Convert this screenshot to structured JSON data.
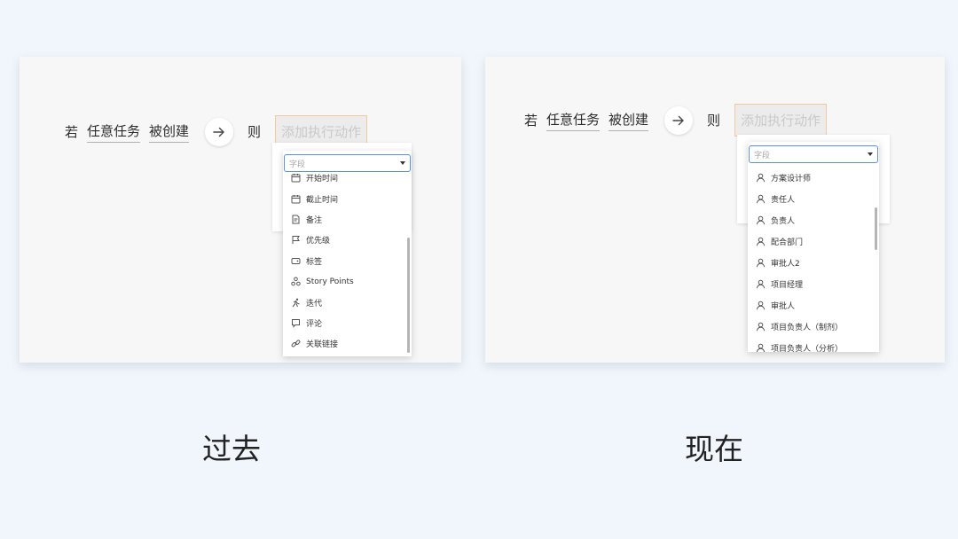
{
  "before": {
    "rule": {
      "if": "若",
      "subject": "任意任务",
      "event": "被创建",
      "then": "则",
      "action_placeholder": "添加执行动作"
    },
    "select_placeholder": "字段",
    "items": [
      {
        "label": "开始时间",
        "icon": "calendar-icon"
      },
      {
        "label": "截止时间",
        "icon": "calendar-icon"
      },
      {
        "label": "备注",
        "icon": "note-icon"
      },
      {
        "label": "优先级",
        "icon": "flag-icon"
      },
      {
        "label": "标签",
        "icon": "tag-icon"
      },
      {
        "label": "Story Points",
        "icon": "story-points-icon"
      },
      {
        "label": "迭代",
        "icon": "sprint-icon"
      },
      {
        "label": "评论",
        "icon": "comment-icon"
      },
      {
        "label": "关联链接",
        "icon": "link-icon"
      }
    ],
    "caption": "过去"
  },
  "after": {
    "rule": {
      "if": "若",
      "subject": "任意任务",
      "event": "被创建",
      "then": "则",
      "action_placeholder": "添加执行动作"
    },
    "select_placeholder": "字段",
    "items": [
      {
        "label": "方案设计师",
        "icon": "user-icon"
      },
      {
        "label": "责任人",
        "icon": "user-icon"
      },
      {
        "label": "负责人",
        "icon": "user-icon"
      },
      {
        "label": "配合部门",
        "icon": "user-icon"
      },
      {
        "label": "审批人2",
        "icon": "user-icon"
      },
      {
        "label": "项目经理",
        "icon": "user-icon"
      },
      {
        "label": "审批人",
        "icon": "user-icon"
      },
      {
        "label": "项目负责人（制剂）",
        "icon": "user-icon"
      },
      {
        "label": "项目负责人（分析）",
        "icon": "user-icon"
      }
    ],
    "caption": "现在"
  }
}
